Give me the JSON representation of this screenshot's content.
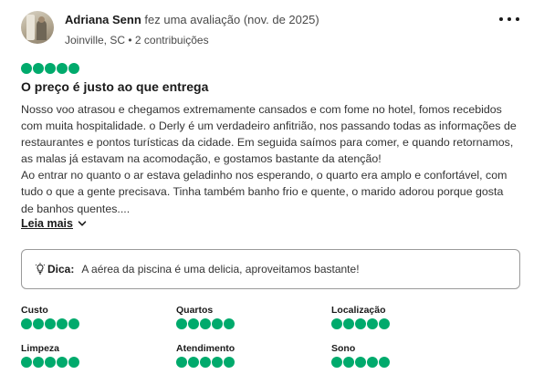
{
  "review": {
    "author": {
      "name": "Adriana Senn",
      "action": "fez uma avaliação (nov. de 2025)",
      "location_contributions": "Joinville, SC • 2 contribuições"
    },
    "rating": 5,
    "title": "O preço é justo ao que entrega",
    "body_lines": [
      "Nosso voo atrasou e chegamos extremamente cansados e com fome no hotel, fomos recebidos",
      "com muita hospitalidade. o Derly é um verdadeiro anfitrião, nos passando todas as informações de",
      "restaurantes e pontos turísticas da cidade. Em seguida saímos para comer, e quando retornamos,",
      "as malas já estavam na acomodação, e gostamos bastante da atenção!",
      "Ao entrar no quanto o ar estava geladinho nos esperando, o quarto era amplo e confortável, com",
      "tudo o que a gente precisava. Tinha também banho frio e quente, o marido adorou porque gosta",
      "de banhos quentes...."
    ],
    "read_more_label": "Leia mais",
    "tip": {
      "label": "Dica:",
      "text": "A aérea da piscina é uma delicia, aproveitamos bastante!"
    },
    "sub_ratings": [
      {
        "label": "Custo",
        "rating": 5
      },
      {
        "label": "Quartos",
        "rating": 5
      },
      {
        "label": "Localização",
        "rating": 5
      },
      {
        "label": "Limpeza",
        "rating": 5
      },
      {
        "label": "Atendimento",
        "rating": 5
      },
      {
        "label": "Sono",
        "rating": 5
      }
    ]
  },
  "icons": {
    "more": "more-options-icon",
    "chevron": "chevron-down-icon",
    "tip": "lightbulb-icon"
  },
  "colors": {
    "bubble": "#00aa6c",
    "text": "#1a1a1a"
  }
}
